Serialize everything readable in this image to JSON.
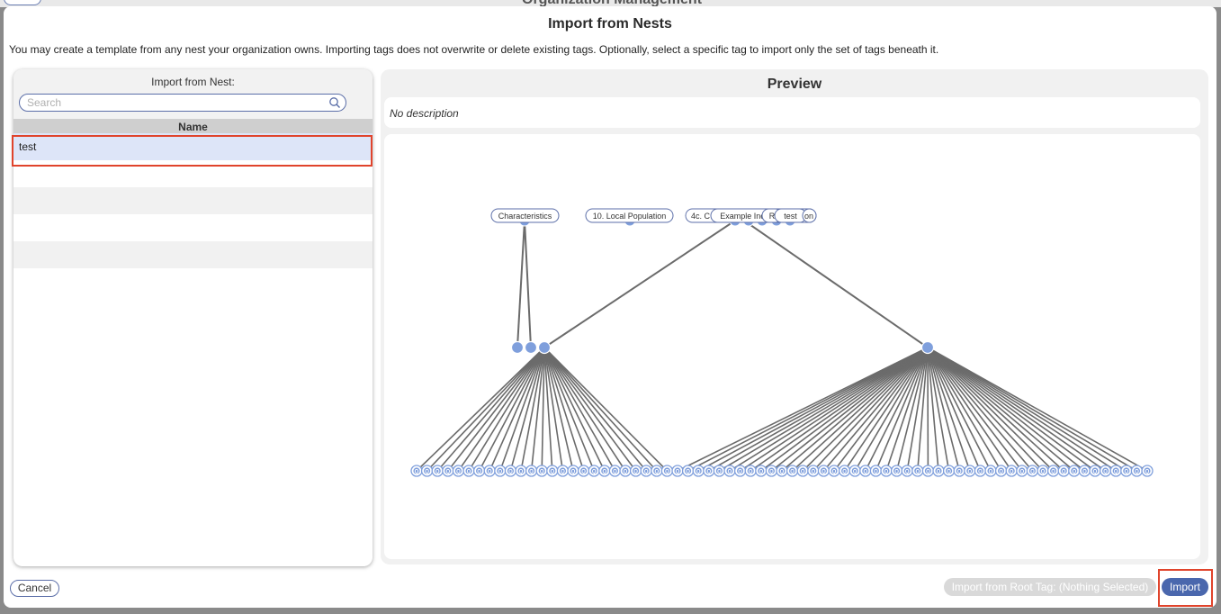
{
  "background": {
    "title": "Organization Management"
  },
  "modal": {
    "title": "Import from Nests",
    "description": "You may create a template from any nest your organization owns. Importing tags does not overwrite or delete existing tags. Optionally, select a specific tag to import only the set of tags beneath it."
  },
  "nest_list": {
    "label": "Import from Nest:",
    "search_placeholder": "Search",
    "column_header": "Name",
    "rows": [
      "test",
      "",
      "",
      "",
      ""
    ],
    "selected_index": 0
  },
  "preview": {
    "title": "Preview",
    "description": "No description",
    "tags": [
      "Characteristics",
      "10. Local Population",
      "4c. C",
      "Example Inc",
      "R",
      "test",
      "on"
    ],
    "leaf_label": "Q"
  },
  "footer": {
    "cancel_label": "Cancel",
    "root_tag_label": "Import from Root Tag: (Nothing Selected)",
    "import_label": "Import"
  },
  "colors": {
    "accent": "#4a67ad",
    "node": "#7f9fdc",
    "selection_row": "#dde5f8",
    "highlight_outline": "#e0442c"
  }
}
